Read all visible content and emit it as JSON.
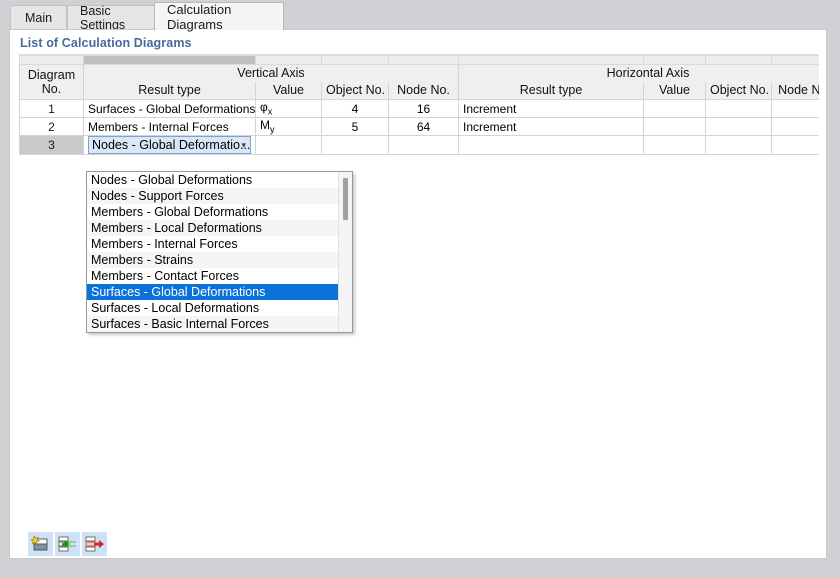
{
  "window": {
    "background_color": "#d0d0d5",
    "panel_color": "#ffffff"
  },
  "tabs": [
    {
      "label": "Main",
      "active": false
    },
    {
      "label": "Basic Settings",
      "active": false
    },
    {
      "label": "Calculation Diagrams",
      "active": true
    }
  ],
  "section": {
    "title": "List of Calculation Diagrams",
    "title_color": "#456a9e"
  },
  "table": {
    "group_headers": {
      "row_no": "Diagram\nNo.",
      "row_no_line1": "Diagram",
      "row_no_line2": "No.",
      "vertical_axis": "Vertical Axis",
      "horizontal_axis": "Horizontal Axis"
    },
    "sub_headers": {
      "v_result_type": "Result type",
      "v_value": "Value",
      "v_object_no": "Object No.",
      "v_node_no": "Node No.",
      "h_result_type": "Result type",
      "h_value": "Value",
      "h_object_no": "Object No.",
      "h_node_no": "Node No."
    },
    "rows": [
      {
        "no": "1",
        "v_result_type": "Surfaces - Global Deformations",
        "v_value_base": "φ",
        "v_value_sub": "x",
        "v_object_no": "4",
        "v_node_no": "16",
        "h_result_type": "Increment",
        "h_value": "",
        "h_object_no": "",
        "h_node_no": "",
        "selected": false
      },
      {
        "no": "2",
        "v_result_type": "Members - Internal Forces",
        "v_value_base": "M",
        "v_value_sub": "y",
        "v_object_no": "5",
        "v_node_no": "64",
        "h_result_type": "Increment",
        "h_value": "",
        "h_object_no": "",
        "h_node_no": "",
        "selected": false
      },
      {
        "no": "3",
        "v_result_type": "Nodes - Global Deformatio...",
        "v_value_base": "",
        "v_value_sub": "",
        "v_object_no": "",
        "v_node_no": "",
        "h_result_type": "",
        "h_value": "",
        "h_object_no": "",
        "h_node_no": "",
        "selected": true,
        "editing": true
      }
    ]
  },
  "dropdown": {
    "open": true,
    "selected_value": "Nodes - Global Deformatio...",
    "highlight_color": "#0a72da",
    "options": [
      {
        "label": "Nodes - Global Deformations",
        "highlighted": false
      },
      {
        "label": "Nodes - Support Forces",
        "highlighted": false
      },
      {
        "label": "Members - Global Deformations",
        "highlighted": false
      },
      {
        "label": "Members - Local Deformations",
        "highlighted": false
      },
      {
        "label": "Members - Internal Forces",
        "highlighted": false
      },
      {
        "label": "Members - Strains",
        "highlighted": false
      },
      {
        "label": "Members - Contact Forces",
        "highlighted": false
      },
      {
        "label": "Surfaces - Global Deformations",
        "highlighted": true
      },
      {
        "label": "Surfaces - Local Deformations",
        "highlighted": false
      },
      {
        "label": "Surfaces - Basic Internal Forces",
        "highlighted": false
      }
    ]
  },
  "toolbar": {
    "buttons": [
      {
        "name": "new-diagram-icon",
        "title": "New"
      },
      {
        "name": "insert-row-icon",
        "title": "Insert Row"
      },
      {
        "name": "delete-row-icon",
        "title": "Delete Row"
      }
    ]
  }
}
